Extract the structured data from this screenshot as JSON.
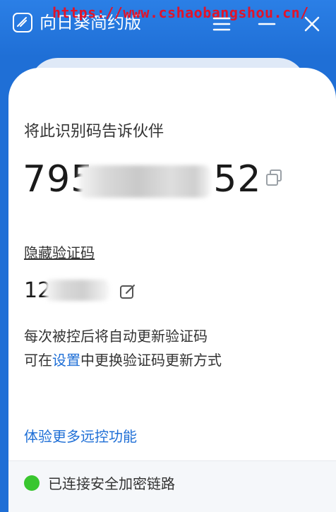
{
  "window": {
    "title": "向日葵简约版",
    "watermark": "https://www.cshaobangshou.cn/"
  },
  "icons": {
    "logo": "sunflower-logo-icon",
    "menu": "menu-icon",
    "minimize": "minimize-icon",
    "close": "close-icon",
    "copy": "copy-icon",
    "edit": "edit-icon",
    "status": "status-dot-icon"
  },
  "identity": {
    "label": "将此识别码告诉伙伴",
    "code_visible_prefix": "795",
    "code_visible_suffix": "52"
  },
  "verification": {
    "label": "隐藏验证码",
    "code_visible_prefix": "12"
  },
  "hints": {
    "line1": "每次被控后将自动更新验证码",
    "line2_before": "可在",
    "line2_link": "设置",
    "line2_after": "中更换验证码更新方式"
  },
  "more_link": "体验更多远控功能",
  "status": {
    "text": "已连接安全加密链路",
    "color": "#39c62f"
  },
  "colors": {
    "brand": "#1f6fd6",
    "link": "#1f6fd6"
  }
}
